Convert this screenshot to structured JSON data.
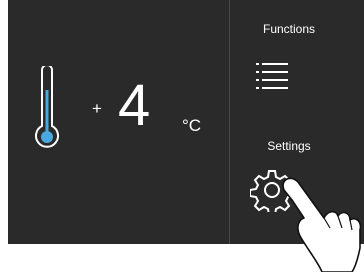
{
  "temperature": {
    "sign": "+",
    "value": "4",
    "unit": "°C"
  },
  "functions": {
    "label": "Functions",
    "icon": "list-icon"
  },
  "settings": {
    "label": "Settings",
    "icon": "gear-icon"
  },
  "colors": {
    "panel": "#2a2a2a",
    "text": "#ffffff",
    "thermometer_accent": "#4aa8e0"
  }
}
